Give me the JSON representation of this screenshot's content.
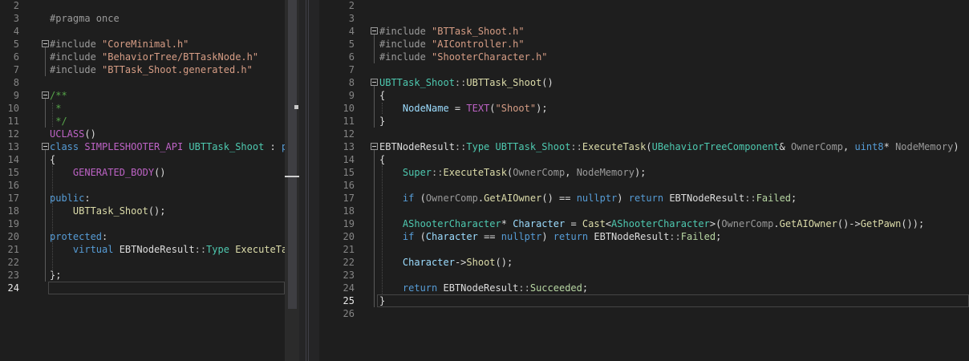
{
  "left_editor": {
    "lines": [
      {
        "n": "2",
        "t": []
      },
      {
        "n": "3",
        "t": [
          [
            "pp",
            "#pragma once"
          ]
        ]
      },
      {
        "n": "4",
        "t": []
      },
      {
        "n": "5",
        "t": [
          [
            "pp",
            "#include "
          ],
          [
            "str",
            "\"CoreMinimal.h\""
          ]
        ]
      },
      {
        "n": "6",
        "t": [
          [
            "pp",
            "#include "
          ],
          [
            "str",
            "\"BehaviorTree/BTTaskNode.h\""
          ]
        ]
      },
      {
        "n": "7",
        "t": [
          [
            "pp",
            "#include "
          ],
          [
            "str",
            "\"BTTask_Shoot.generated.h\""
          ]
        ]
      },
      {
        "n": "8",
        "t": []
      },
      {
        "n": "9",
        "t": [
          [
            "cm",
            "/**"
          ]
        ]
      },
      {
        "n": "10",
        "t": [
          [
            "cm",
            " *"
          ]
        ]
      },
      {
        "n": "11",
        "t": [
          [
            "cm",
            " */"
          ]
        ]
      },
      {
        "n": "12",
        "t": [
          [
            "mac",
            "UCLASS"
          ],
          [
            "pl",
            "()"
          ]
        ]
      },
      {
        "n": "13",
        "t": [
          [
            "kw",
            "class "
          ],
          [
            "mac",
            "SIMPLESHOOTER_API "
          ],
          [
            "ty",
            "UBTTask_Shoot"
          ],
          [
            "pl",
            " : "
          ],
          [
            "kw",
            "pu"
          ]
        ]
      },
      {
        "n": "14",
        "t": [
          [
            "pl",
            "{"
          ]
        ]
      },
      {
        "n": "15",
        "t": [
          [
            "pl",
            "    "
          ],
          [
            "mac",
            "GENERATED_BODY"
          ],
          [
            "pl",
            "()"
          ]
        ]
      },
      {
        "n": "16",
        "t": []
      },
      {
        "n": "17",
        "t": [
          [
            "kw",
            "public"
          ],
          [
            "pl",
            ":"
          ]
        ]
      },
      {
        "n": "18",
        "t": [
          [
            "pl",
            "    "
          ],
          [
            "fn",
            "UBTTask_Shoot"
          ],
          [
            "pl",
            "();"
          ]
        ]
      },
      {
        "n": "19",
        "t": []
      },
      {
        "n": "20",
        "t": [
          [
            "kw",
            "protected"
          ],
          [
            "pl",
            ":"
          ]
        ]
      },
      {
        "n": "21",
        "t": [
          [
            "pl",
            "    "
          ],
          [
            "kw",
            "virtual "
          ],
          [
            "pl",
            "EBTNodeResult"
          ],
          [
            "op",
            "::"
          ],
          [
            "ty",
            "Type "
          ],
          [
            "fn",
            "ExecuteTas"
          ]
        ]
      },
      {
        "n": "22",
        "t": []
      },
      {
        "n": "23",
        "t": [
          [
            "pl",
            "};"
          ]
        ]
      },
      {
        "n": "24",
        "t": []
      }
    ],
    "active_line": "24"
  },
  "right_editor": {
    "lines": [
      {
        "n": "2",
        "t": []
      },
      {
        "n": "3",
        "t": []
      },
      {
        "n": "4",
        "t": [
          [
            "pp",
            "#include "
          ],
          [
            "str",
            "\"BTTask_Shoot.h\""
          ]
        ]
      },
      {
        "n": "5",
        "t": [
          [
            "pp",
            "#include "
          ],
          [
            "str",
            "\"AIController.h\""
          ]
        ]
      },
      {
        "n": "6",
        "t": [
          [
            "pp",
            "#include "
          ],
          [
            "str",
            "\"ShooterCharacter.h\""
          ]
        ]
      },
      {
        "n": "7",
        "t": []
      },
      {
        "n": "8",
        "t": [
          [
            "ty",
            "UBTTask_Shoot"
          ],
          [
            "op",
            "::"
          ],
          [
            "fn",
            "UBTTask_Shoot"
          ],
          [
            "pl",
            "()"
          ]
        ]
      },
      {
        "n": "9",
        "t": [
          [
            "pl",
            "{"
          ]
        ]
      },
      {
        "n": "10",
        "t": [
          [
            "pl",
            "    "
          ],
          [
            "var",
            "NodeName"
          ],
          [
            "pl",
            " = "
          ],
          [
            "mac",
            "TEXT"
          ],
          [
            "pl",
            "("
          ],
          [
            "str",
            "\"Shoot\""
          ],
          [
            "pl",
            ");"
          ]
        ]
      },
      {
        "n": "11",
        "t": [
          [
            "pl",
            "}"
          ]
        ]
      },
      {
        "n": "12",
        "t": []
      },
      {
        "n": "13",
        "t": [
          [
            "pl",
            "EBTNodeResult"
          ],
          [
            "op",
            "::"
          ],
          [
            "ty",
            "Type "
          ],
          [
            "ty",
            "UBTTask_Shoot"
          ],
          [
            "op",
            "::"
          ],
          [
            "fn",
            "ExecuteTask"
          ],
          [
            "pl",
            "("
          ],
          [
            "ty",
            "UBehaviorTreeComponent"
          ],
          [
            "pl",
            "& "
          ],
          [
            "prm",
            "OwnerComp"
          ],
          [
            "pl",
            ", "
          ],
          [
            "kw",
            "uint8"
          ],
          [
            "pl",
            "* "
          ],
          [
            "prm",
            "NodeMemory"
          ],
          [
            "pl",
            ")"
          ]
        ]
      },
      {
        "n": "14",
        "t": [
          [
            "pl",
            "{"
          ]
        ]
      },
      {
        "n": "15",
        "t": [
          [
            "pl",
            "    "
          ],
          [
            "ty",
            "Super"
          ],
          [
            "op",
            "::"
          ],
          [
            "fn",
            "ExecuteTask"
          ],
          [
            "pl",
            "("
          ],
          [
            "prm",
            "OwnerComp"
          ],
          [
            "pl",
            ", "
          ],
          [
            "prm",
            "NodeMemory"
          ],
          [
            "pl",
            ");"
          ]
        ]
      },
      {
        "n": "16",
        "t": []
      },
      {
        "n": "17",
        "t": [
          [
            "pl",
            "    "
          ],
          [
            "kw",
            "if "
          ],
          [
            "pl",
            "("
          ],
          [
            "prm",
            "OwnerComp"
          ],
          [
            "pl",
            "."
          ],
          [
            "fn",
            "GetAIOwner"
          ],
          [
            "pl",
            "() == "
          ],
          [
            "kw",
            "nullptr"
          ],
          [
            "pl",
            ") "
          ],
          [
            "kw",
            "return "
          ],
          [
            "pl",
            "EBTNodeResult"
          ],
          [
            "op",
            "::"
          ],
          [
            "en",
            "Failed"
          ],
          [
            "pl",
            ";"
          ]
        ]
      },
      {
        "n": "18",
        "t": []
      },
      {
        "n": "19",
        "t": [
          [
            "pl",
            "    "
          ],
          [
            "ty",
            "AShooterCharacter"
          ],
          [
            "pl",
            "* "
          ],
          [
            "var",
            "Character"
          ],
          [
            "pl",
            " = "
          ],
          [
            "fn",
            "Cast"
          ],
          [
            "pl",
            "<"
          ],
          [
            "ty",
            "AShooterCharacter"
          ],
          [
            "pl",
            ">("
          ],
          [
            "prm",
            "OwnerComp"
          ],
          [
            "pl",
            "."
          ],
          [
            "fn",
            "GetAIOwner"
          ],
          [
            "pl",
            "()->"
          ],
          [
            "fn",
            "GetPawn"
          ],
          [
            "pl",
            "());"
          ]
        ]
      },
      {
        "n": "20",
        "t": [
          [
            "pl",
            "    "
          ],
          [
            "kw",
            "if "
          ],
          [
            "pl",
            "("
          ],
          [
            "var",
            "Character"
          ],
          [
            "pl",
            " == "
          ],
          [
            "kw",
            "nullptr"
          ],
          [
            "pl",
            ") "
          ],
          [
            "kw",
            "return "
          ],
          [
            "pl",
            "EBTNodeResult"
          ],
          [
            "op",
            "::"
          ],
          [
            "en",
            "Failed"
          ],
          [
            "pl",
            ";"
          ]
        ]
      },
      {
        "n": "21",
        "t": []
      },
      {
        "n": "22",
        "t": [
          [
            "pl",
            "    "
          ],
          [
            "var",
            "Character"
          ],
          [
            "pl",
            "->"
          ],
          [
            "fn",
            "Shoot"
          ],
          [
            "pl",
            "();"
          ]
        ]
      },
      {
        "n": "23",
        "t": []
      },
      {
        "n": "24",
        "t": [
          [
            "pl",
            "    "
          ],
          [
            "kw",
            "return "
          ],
          [
            "pl",
            "EBTNodeResult"
          ],
          [
            "op",
            "::"
          ],
          [
            "en",
            "Succeeded"
          ],
          [
            "pl",
            ";"
          ]
        ]
      },
      {
        "n": "25",
        "t": [
          [
            "pl",
            "}"
          ]
        ]
      },
      {
        "n": "26",
        "t": []
      }
    ],
    "active_line": "25"
  }
}
